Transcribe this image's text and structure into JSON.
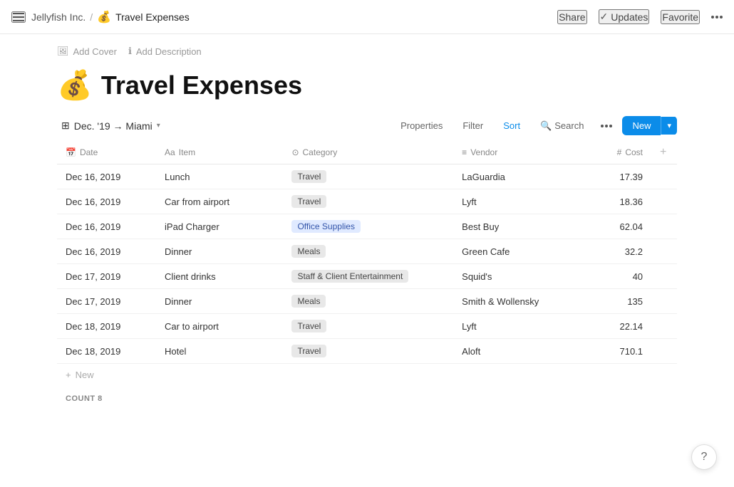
{
  "topNav": {
    "hamburger": "menu",
    "breadcrumb": {
      "org": "Jellyfish Inc.",
      "separator": "/",
      "pageIcon": "💰",
      "page": "Travel Expenses"
    },
    "share": "Share",
    "updates": "Updates",
    "favorite": "Favorite"
  },
  "pageActions": {
    "addCover": "Add Cover",
    "addDescription": "Add Description"
  },
  "pageTitle": {
    "emoji": "💰",
    "title": "Travel Expenses"
  },
  "toolbar": {
    "viewLabel": "Dec. '19 → Miami",
    "properties": "Properties",
    "filter": "Filter",
    "sort": "Sort",
    "search": "Search",
    "more": "...",
    "newMain": "New",
    "newArrow": "▾"
  },
  "tableHeaders": {
    "date": "Date",
    "item": "Item",
    "category": "Category",
    "vendor": "Vendor",
    "cost": "Cost"
  },
  "tableRows": [
    {
      "date": "Dec 16, 2019",
      "item": "Lunch",
      "category": "Travel",
      "categoryClass": "travel",
      "vendor": "LaGuardia",
      "cost": "17.39"
    },
    {
      "date": "Dec 16, 2019",
      "item": "Car from airport",
      "category": "Travel",
      "categoryClass": "travel",
      "vendor": "Lyft",
      "cost": "18.36"
    },
    {
      "date": "Dec 16, 2019",
      "item": "iPad Charger",
      "category": "Office Supplies",
      "categoryClass": "office",
      "vendor": "Best Buy",
      "cost": "62.04"
    },
    {
      "date": "Dec 16, 2019",
      "item": "Dinner",
      "category": "Meals",
      "categoryClass": "meals",
      "vendor": "Green Cafe",
      "cost": "32.2"
    },
    {
      "date": "Dec 17, 2019",
      "item": "Client drinks",
      "category": "Staff & Client Entertainment",
      "categoryClass": "staff",
      "vendor": "Squid's",
      "cost": "40"
    },
    {
      "date": "Dec 17, 2019",
      "item": "Dinner",
      "category": "Meals",
      "categoryClass": "meals",
      "vendor": "Smith & Wollensky",
      "cost": "135"
    },
    {
      "date": "Dec 18, 2019",
      "item": "Car to airport",
      "category": "Travel",
      "categoryClass": "travel",
      "vendor": "Lyft",
      "cost": "22.14"
    },
    {
      "date": "Dec 18, 2019",
      "item": "Hotel",
      "category": "Travel",
      "categoryClass": "travel",
      "vendor": "Aloft",
      "cost": "710.1"
    }
  ],
  "addNewLabel": "New",
  "countLabel": "COUNT",
  "countValue": "8",
  "helpLabel": "?"
}
